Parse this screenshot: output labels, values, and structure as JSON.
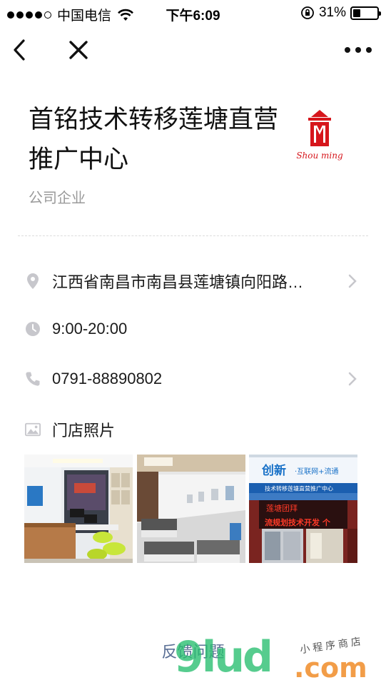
{
  "status_bar": {
    "carrier": "中国电信",
    "time": "下午6:09",
    "battery_text": "31%",
    "battery_level": 0.31
  },
  "nav": {
    "icons": [
      "back-arrow-icon",
      "close-icon",
      "more-dots-icon"
    ]
  },
  "store": {
    "name_line1": "首铭技术转移莲塘直营",
    "name_line2": "推广中心",
    "category": "公司企业",
    "logo_text": "Shou ming",
    "logo_colors": {
      "red": "#d6161c"
    }
  },
  "info": {
    "address": "江西省南昌市南昌县莲塘镇向阳路…",
    "hours": "9:00-20:00",
    "phone": "0791-88890802",
    "photos_label": "门店照片"
  },
  "photos": {
    "p3_sign_top": "创新",
    "p3_sign_top_sub": "·互联网+流通",
    "p3_sign_banner": "技术转移莲塘直营推广中心",
    "p3_led_line1": "莲塘团拜",
    "p3_led_line2": "流规划技术开发 个"
  },
  "footer": {
    "feedback": "反馈问题",
    "watermark_main": "9lud",
    "watermark_domain": ".com",
    "watermark_sub": "小程序商店"
  },
  "colors": {
    "icon_gray": "#c7c7cc",
    "link_blue": "#5a6f95",
    "text_gray": "#9a9a9a"
  }
}
